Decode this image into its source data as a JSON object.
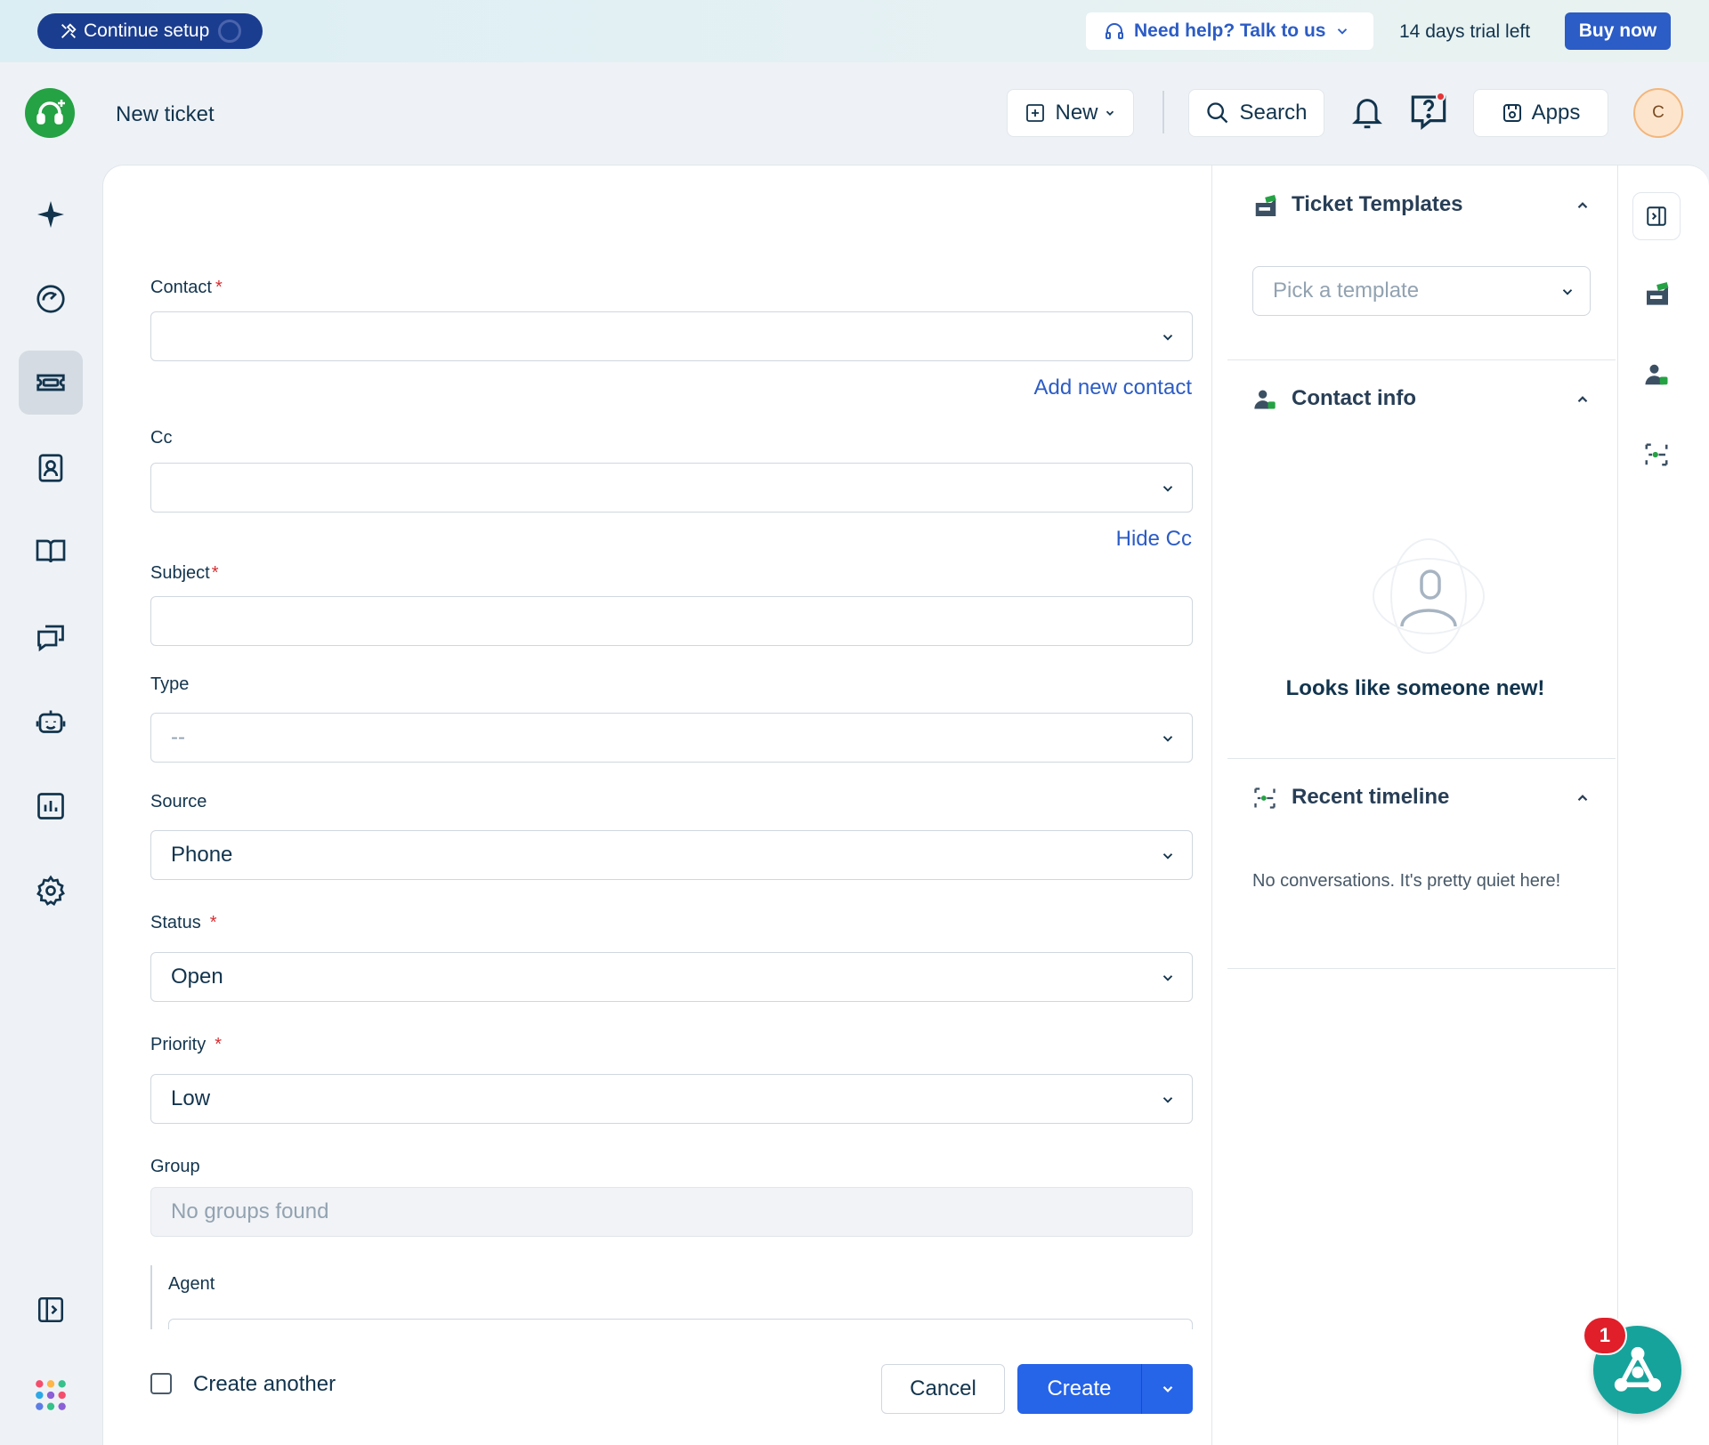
{
  "banner": {
    "continue_setup": "Continue setup",
    "help": "Need help? Talk to us",
    "trial": "14 days trial left",
    "buy_now": "Buy now"
  },
  "header": {
    "title": "New ticket",
    "new_label": "New",
    "search_label": "Search",
    "apps_label": "Apps",
    "avatar_initial": "C"
  },
  "nav": {
    "items": [
      "freddy-ai",
      "dashboard",
      "tickets",
      "contacts",
      "solutions",
      "conversations",
      "bots",
      "analytics",
      "admin-settings"
    ],
    "active": "tickets"
  },
  "form": {
    "contact": {
      "label": "Contact",
      "value": ""
    },
    "add_new_contact": "Add new contact",
    "cc": {
      "label": "Cc",
      "value": ""
    },
    "hide_cc": "Hide Cc",
    "subject": {
      "label": "Subject",
      "value": ""
    },
    "type": {
      "label": "Type",
      "value": "--"
    },
    "source": {
      "label": "Source",
      "value": "Phone"
    },
    "status": {
      "label": "Status",
      "value": "Open"
    },
    "priority": {
      "label": "Priority",
      "value": "Low"
    },
    "group": {
      "label": "Group",
      "value": "No groups found"
    },
    "agent": {
      "label": "Agent"
    },
    "required_marker": "*",
    "create_another": "Create another",
    "cancel": "Cancel",
    "create": "Create"
  },
  "sidebar": {
    "ticket_templates": {
      "title": "Ticket Templates",
      "placeholder": "Pick a template"
    },
    "contact_info": {
      "title": "Contact info",
      "empty": "Looks like someone new!"
    },
    "recent_timeline": {
      "title": "Recent timeline",
      "empty": "No conversations. It's pretty quiet here!"
    }
  },
  "widget": {
    "badge_count": "1"
  },
  "colors": {
    "primary": "#2664e8",
    "link": "#2c5cc5",
    "banner_button": "#1b3d8f",
    "logo_green": "#25a244",
    "required_red": "#d72d30",
    "fab_teal": "#16a39b"
  }
}
